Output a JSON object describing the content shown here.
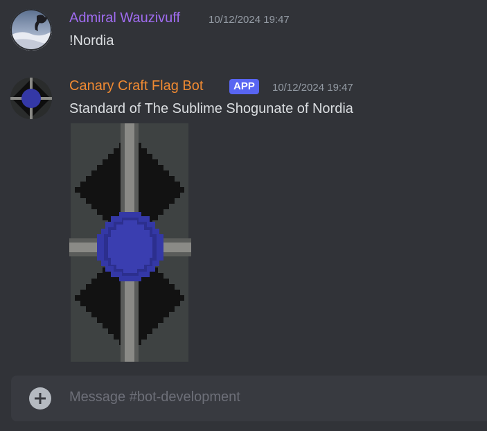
{
  "messages": [
    {
      "author": "Admiral Wauzivuff",
      "author_color": "#a06cf0",
      "timestamp": "10/12/2024 19:47",
      "content": "!Nordia"
    },
    {
      "author": "Canary Craft Flag Bot",
      "author_color": "#f08a32",
      "badge": "APP",
      "timestamp": "10/12/2024 19:47",
      "content": "Standard of The Sublime Shogunate of Nordia",
      "attachment": {
        "type": "banner-image",
        "colors": {
          "field": "#3e4242",
          "pattern": "#121212",
          "cross": "#8a8a86",
          "roundel": "#3438a6"
        }
      }
    }
  ],
  "composer": {
    "placeholder": "Message #bot-development",
    "add_icon": "plus-circle-icon"
  }
}
